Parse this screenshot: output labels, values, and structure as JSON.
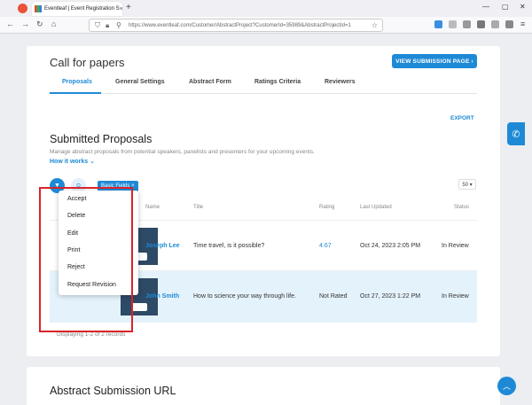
{
  "browser": {
    "tab_title": "Eventleaf | Event Registration S",
    "tab_close": "×",
    "new_tab": "+",
    "url": "https://www.eventleaf.com/Customer/AbstractProject?CustomerId=35989&AbstractProjectId=1",
    "win_min": "—",
    "win_max": "▢",
    "win_close": "✕"
  },
  "header": {
    "title": "Call for papers",
    "cta": "VIEW SUBMISSION PAGE ›"
  },
  "tabs": [
    "Proposals",
    "General Settings",
    "Abstract Form",
    "Ratings Criteria",
    "Reviewers"
  ],
  "export_label": "EXPORT",
  "section": {
    "title": "Submitted Proposals",
    "subtitle": "Manage abstract proposals from potential speakers, panelists and presenters for your upcoming events.",
    "how": "How it works ⌄"
  },
  "toolbar": {
    "chip": "Basic Fields ×",
    "per_page": "50 ▾"
  },
  "columns": [
    "Name",
    "Title",
    "Rating",
    "Last Updated",
    "Status"
  ],
  "rows": [
    {
      "name": "Joseph Lee",
      "title": "Time travel, is it possible?",
      "rating": "4.67",
      "updated": "Oct 24, 2023 2:05 PM",
      "status": "In Review"
    },
    {
      "name": "John Smith",
      "title": "How to science your way through life.",
      "rating": "Not Rated",
      "updated": "Oct 27, 2023 1:22 PM",
      "status": "In Review"
    }
  ],
  "footer": "Displaying 1-2 of 2 records",
  "menu": [
    "Accept",
    "Delete",
    "Edit",
    "Print",
    "Reject",
    "Request Revision"
  ],
  "section2_title": "Abstract Submission URL",
  "colors": {
    "accent": "#1e8ad6",
    "highlight": "#d9232a"
  }
}
